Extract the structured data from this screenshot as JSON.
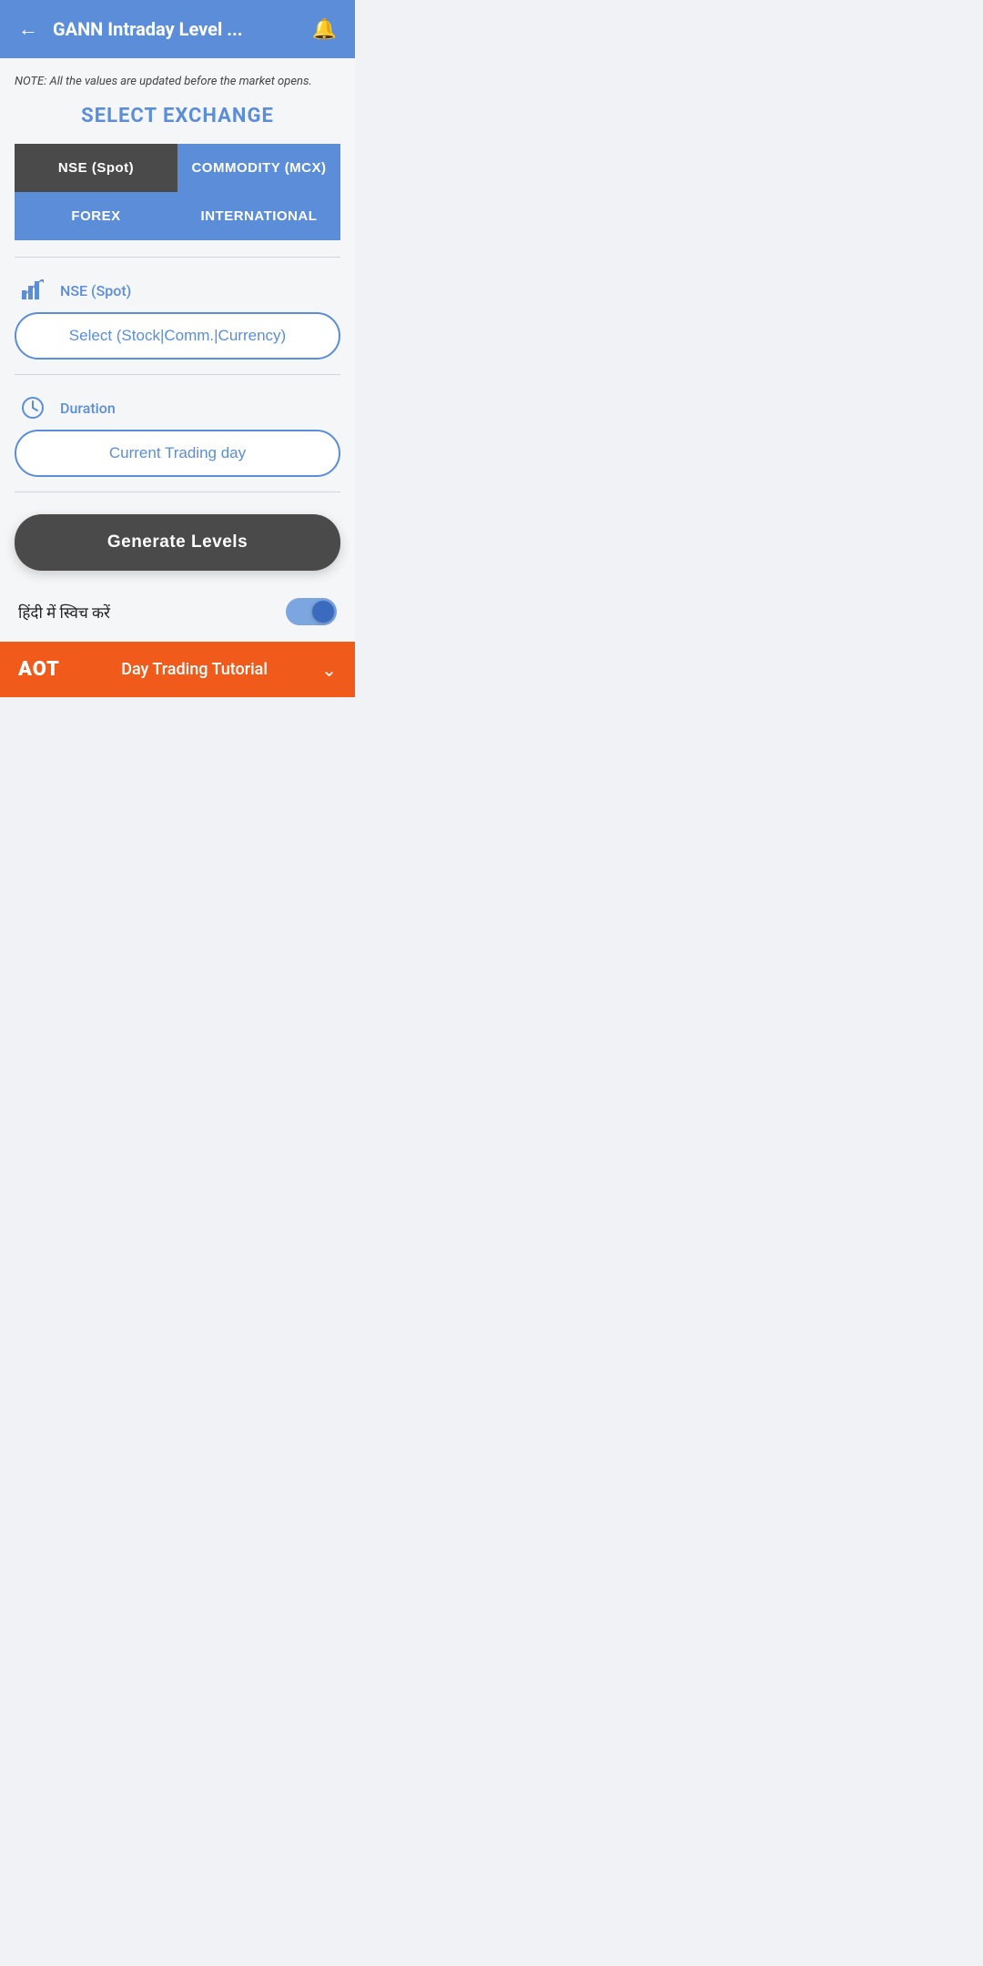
{
  "header": {
    "title": "GANN Intraday Level ...",
    "back_label": "←",
    "bell_label": "🔔"
  },
  "note": {
    "text": "NOTE: All the values are updated before the market opens."
  },
  "select_exchange": {
    "title": "SELECT EXCHANGE",
    "buttons": [
      {
        "id": "nse",
        "label": "NSE (Spot)",
        "active": true
      },
      {
        "id": "mcx",
        "label": "COMMODITY (MCX)",
        "active": false
      },
      {
        "id": "forex",
        "label": "FOREX",
        "active": false
      },
      {
        "id": "international",
        "label": "INTERNATIONAL",
        "active": false
      }
    ]
  },
  "stock_section": {
    "icon": "📊",
    "label": "NSE (Spot)",
    "select_placeholder": "Select (Stock|Comm.|Currency)"
  },
  "duration_section": {
    "icon": "🕐",
    "label": "Duration",
    "current_value": "Current Trading day"
  },
  "generate_button": {
    "label": "Generate Levels"
  },
  "hindi_toggle": {
    "label": "हिंदी में स्विच करें",
    "enabled": true
  },
  "aot_banner": {
    "logo": "AOT",
    "text": "Day Trading Tutorial",
    "chevron": "⌄"
  }
}
